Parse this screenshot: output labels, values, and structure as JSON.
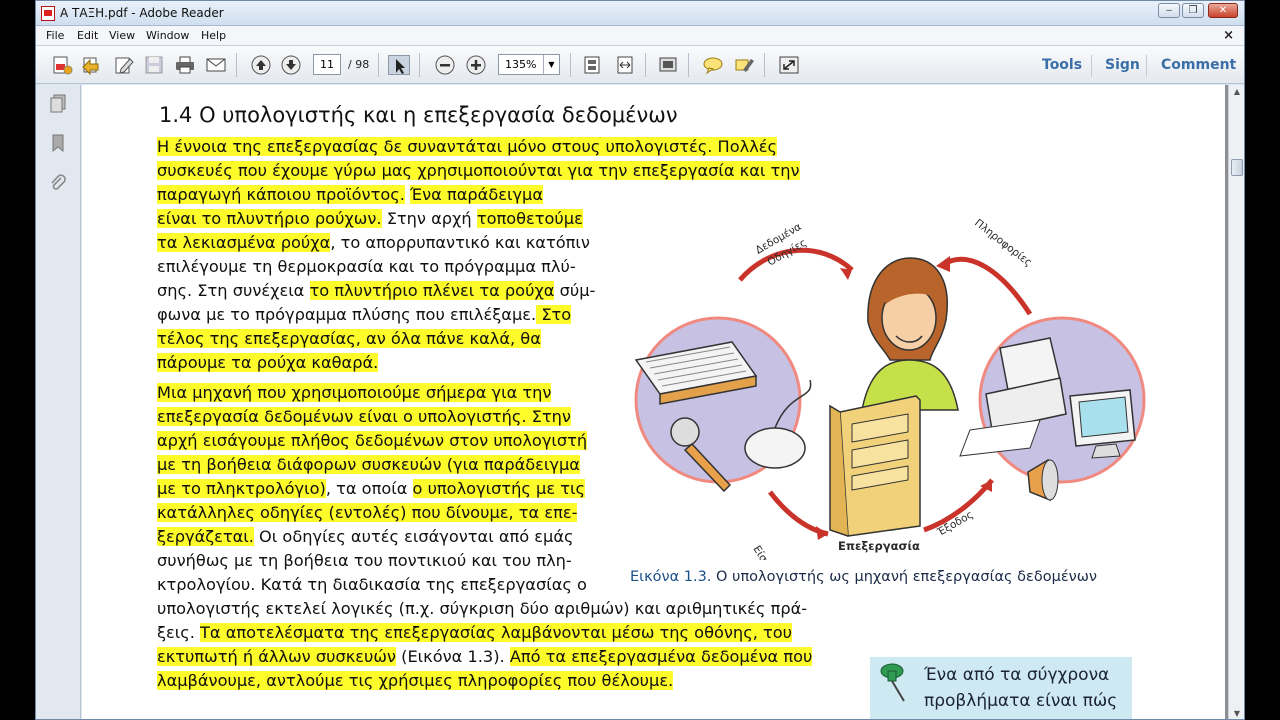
{
  "window": {
    "title": "Α ΤΑΞΗ.pdf - Adobe Reader"
  },
  "menu": [
    "File",
    "Edit",
    "View",
    "Window",
    "Help"
  ],
  "toolbar": {
    "page_current": "11",
    "page_total": "/ 98",
    "zoom": "135%",
    "links": [
      "Tools",
      "Sign",
      "Comment"
    ]
  },
  "document": {
    "heading": "1.4 Ο υπολογιστής και η επεξεργασία δεδομένων",
    "caption_label": "Εικόνα 1.3.",
    "caption_text": " Ο υπολογιστής ως μηχανή επεξεργασίας δεδομένων",
    "figure_labels": {
      "input_data": "Δεδομένα",
      "input_instructions": "Οδηγίες",
      "information": "Πληροφορίες",
      "input": "Είσοδος",
      "output": "Έξοδος",
      "processing": "Επεξεργασία"
    },
    "note": [
      "Ένα από τα σύγχρονα",
      "προβλήματα είναι πώς"
    ]
  },
  "colors": {
    "highlight": "#fdfb2a",
    "link": "#3b6fa8",
    "note_bg": "#cfe9f3"
  }
}
